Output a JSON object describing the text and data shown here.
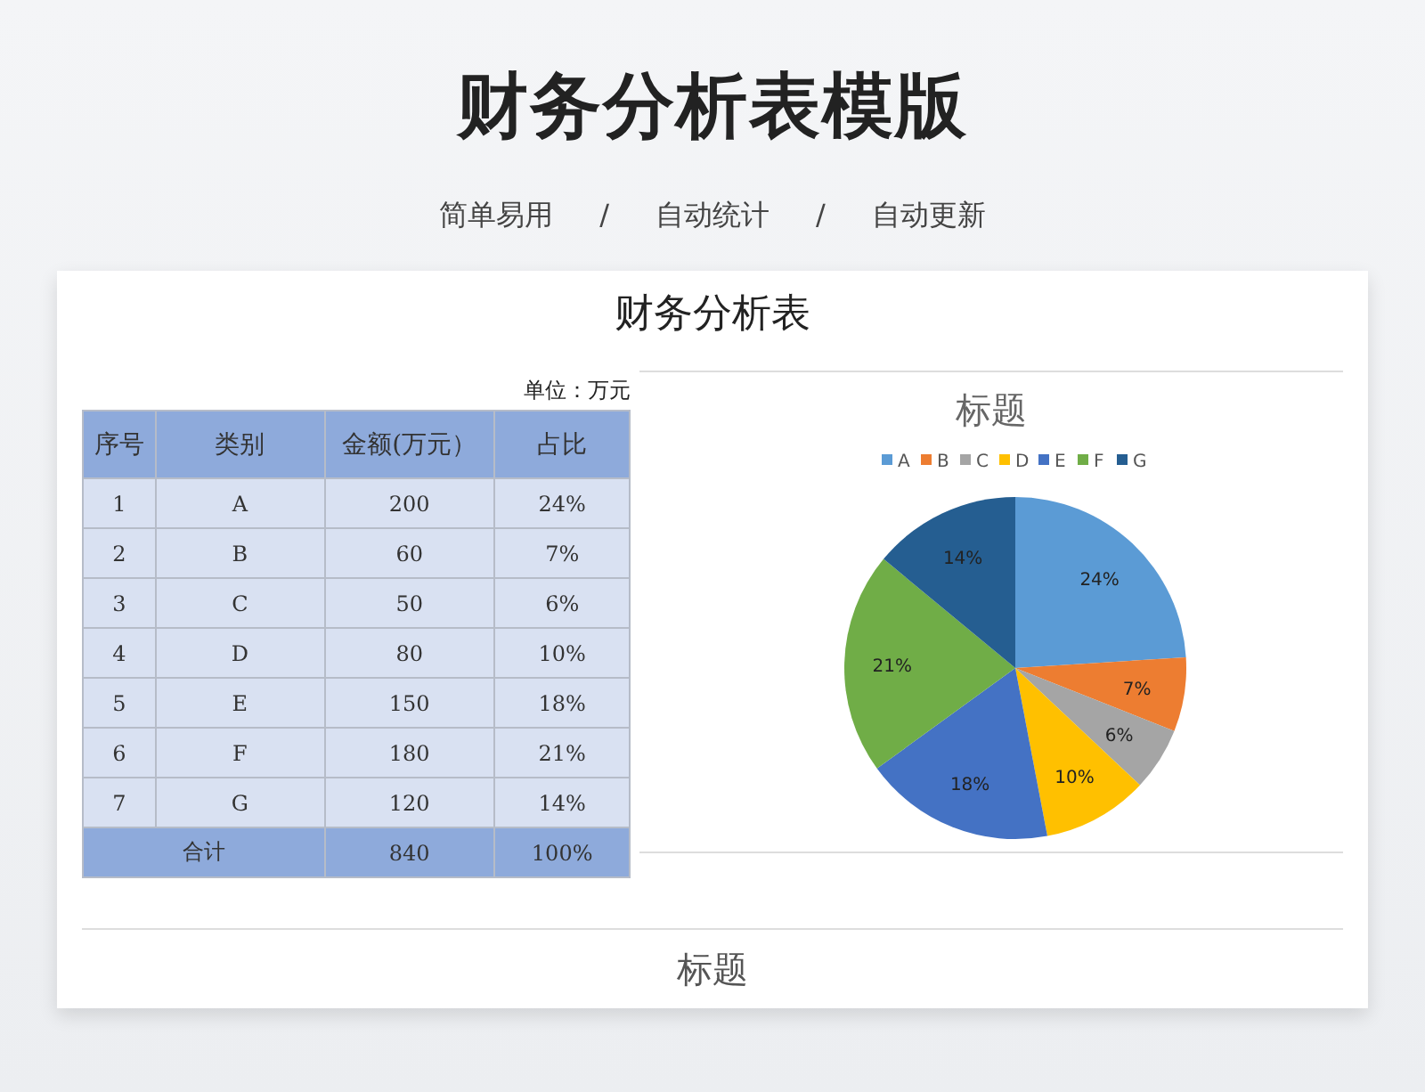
{
  "page_title": "财务分析表模版",
  "features": [
    {
      "label": "简单易用"
    },
    {
      "label": "自动统计"
    },
    {
      "label": "自动更新"
    }
  ],
  "separator": "/",
  "sheet": {
    "title": "财务分析表",
    "unit": "单位：万元",
    "table": {
      "columns": [
        "序号",
        "类别",
        "金额(万元）",
        "占比"
      ],
      "rows": [
        [
          "1",
          "A",
          "200",
          "24%"
        ],
        [
          "2",
          "B",
          "60",
          "7%"
        ],
        [
          "3",
          "C",
          "50",
          "6%"
        ],
        [
          "4",
          "D",
          "80",
          "10%"
        ],
        [
          "5",
          "E",
          "150",
          "18%"
        ],
        [
          "6",
          "F",
          "180",
          "21%"
        ],
        [
          "7",
          "G",
          "120",
          "14%"
        ]
      ],
      "total": [
        "合计",
        "840",
        "100%"
      ]
    },
    "chart_data": {
      "type": "pie",
      "title": "标题",
      "categories": [
        "A",
        "B",
        "C",
        "D",
        "E",
        "F",
        "G"
      ],
      "values": [
        24,
        7,
        6,
        10,
        18,
        21,
        14
      ],
      "colors": [
        "#5b9bd5",
        "#ed7d31",
        "#a5a5a5",
        "#ffc000",
        "#4472c4",
        "#70ad47",
        "#255e91"
      ],
      "value_labels": [
        "24%",
        "7%",
        "6%",
        "10%",
        "18%",
        "21%",
        "14%"
      ],
      "legend": "top"
    },
    "footer_title": "标题"
  }
}
